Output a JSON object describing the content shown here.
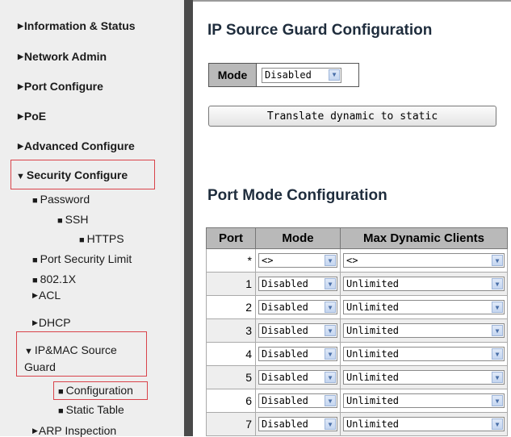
{
  "sidebar": {
    "items": [
      {
        "label": "Information & Status"
      },
      {
        "label": "Network Admin"
      },
      {
        "label": "Port Configure"
      },
      {
        "label": "PoE"
      },
      {
        "label": "Advanced Configure"
      },
      {
        "label": "Security Configure"
      }
    ],
    "sub": {
      "password": "Password",
      "ssh": "SSH",
      "https": "HTTPS",
      "port_security": "Port Security Limit",
      "dot1x": "802.1X",
      "acl": "ACL",
      "dhcp": "DHCP",
      "ipmac": "IP&MAC Source Guard",
      "configuration": "Configuration",
      "static_table": "Static Table",
      "arp": "ARP Inspection"
    },
    "highlight_color": "#d9434a"
  },
  "main": {
    "title": "IP Source Guard Configuration",
    "mode_label": "Mode",
    "mode_value": "Disabled",
    "translate_button": "Translate dynamic to static",
    "port_title": "Port Mode Configuration",
    "headers": {
      "port": "Port",
      "mode": "Mode",
      "max": "Max Dynamic Clients"
    },
    "rows": [
      {
        "port": "*",
        "mode": "<>",
        "max": "<>"
      },
      {
        "port": "1",
        "mode": "Disabled",
        "max": "Unlimited"
      },
      {
        "port": "2",
        "mode": "Disabled",
        "max": "Unlimited"
      },
      {
        "port": "3",
        "mode": "Disabled",
        "max": "Unlimited"
      },
      {
        "port": "4",
        "mode": "Disabled",
        "max": "Unlimited"
      },
      {
        "port": "5",
        "mode": "Disabled",
        "max": "Unlimited"
      },
      {
        "port": "6",
        "mode": "Disabled",
        "max": "Unlimited"
      },
      {
        "port": "7",
        "mode": "Disabled",
        "max": "Unlimited"
      }
    ]
  }
}
